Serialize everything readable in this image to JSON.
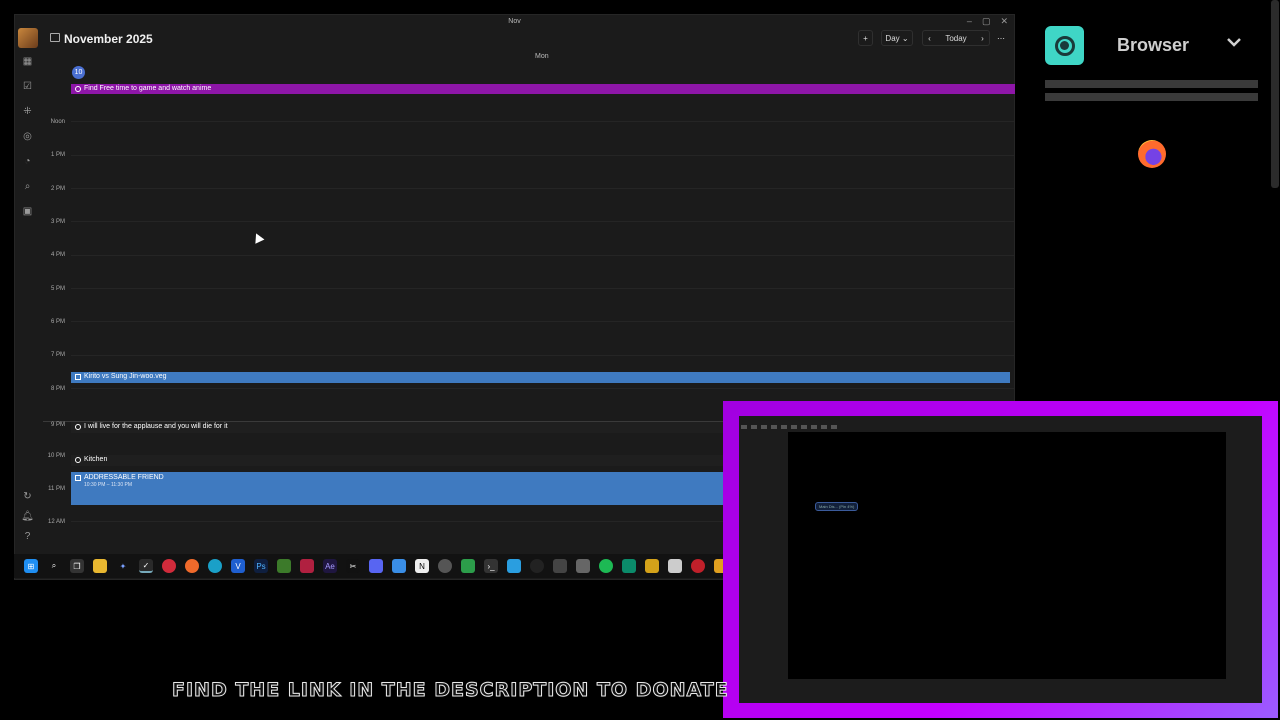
{
  "window": {
    "title": "Nov",
    "controls": [
      "–",
      "▢",
      "✕"
    ]
  },
  "header": {
    "month_title": "November 2025",
    "add_label": "+",
    "view_label": "Day ⌄",
    "prev_label": "‹",
    "today_label": "Today",
    "next_label": "›",
    "more_label": "⋯"
  },
  "day": {
    "weekday": "Mon",
    "date": "10"
  },
  "time_labels": [
    "Noon",
    "1 PM",
    "2 PM",
    "3 PM",
    "4 PM",
    "5 PM",
    "6 PM",
    "7 PM",
    "8 PM",
    "9 PM",
    "10 PM",
    "11 PM",
    "12 AM"
  ],
  "events": [
    {
      "title": "Find Free time to game and watch anime",
      "color": "#8e16a8"
    },
    {
      "title": "Kirito vs Sung Jin-woo.veg",
      "color": "#3f7ac0"
    },
    {
      "title": "I will live for the applause and you will die for it",
      "color": "#1f1f1f"
    },
    {
      "title": "Kitchen",
      "color": "#1f1f1f"
    },
    {
      "title": "ADDRESSABLE FRIEND",
      "time": "10:30 PM – 11:30 PM",
      "color": "#3f7ac0"
    }
  ],
  "sidebar_icons": [
    "calendar-icon",
    "checklist-icon",
    "apps-icon",
    "target-icon",
    "clock-icon",
    "search-icon",
    "archive-icon",
    "sync-icon",
    "bell-icon",
    "help-icon"
  ],
  "taskbar_icons": [
    "windows-start-icon",
    "search-icon",
    "task-view-icon",
    "file-explorer-icon",
    "copilot-icon",
    "tasks-app-icon",
    "vivaldi-icon",
    "firefox-icon",
    "edge-icon",
    "v-app-icon",
    "photoshop-icon",
    "green-app-icon",
    "red-app-icon",
    "after-effects-icon",
    "capcut-icon",
    "discord-icon",
    "weather-icon",
    "notion-icon",
    "chrome-icon",
    "whatsapp-icon",
    "terminal-icon",
    "telegram-icon",
    "media-icon",
    "keyboard-icon",
    "app-icon",
    "spotify-icon",
    "fl-icon",
    "bolt-icon",
    "steam-icon",
    "opera-icon",
    "shield-icon"
  ],
  "right_panel": {
    "browser_label": "Browser"
  },
  "colors": {
    "accent": "#4a6fd1",
    "pip_border": "#b800f0",
    "browser_pill": "#3fd6c6"
  },
  "pip": {
    "chip_text": "Main Dis...  (Pin 4%)"
  },
  "banner": {
    "text": "FIND THE LINK IN THE DESCRIPTION TO DONATE"
  }
}
